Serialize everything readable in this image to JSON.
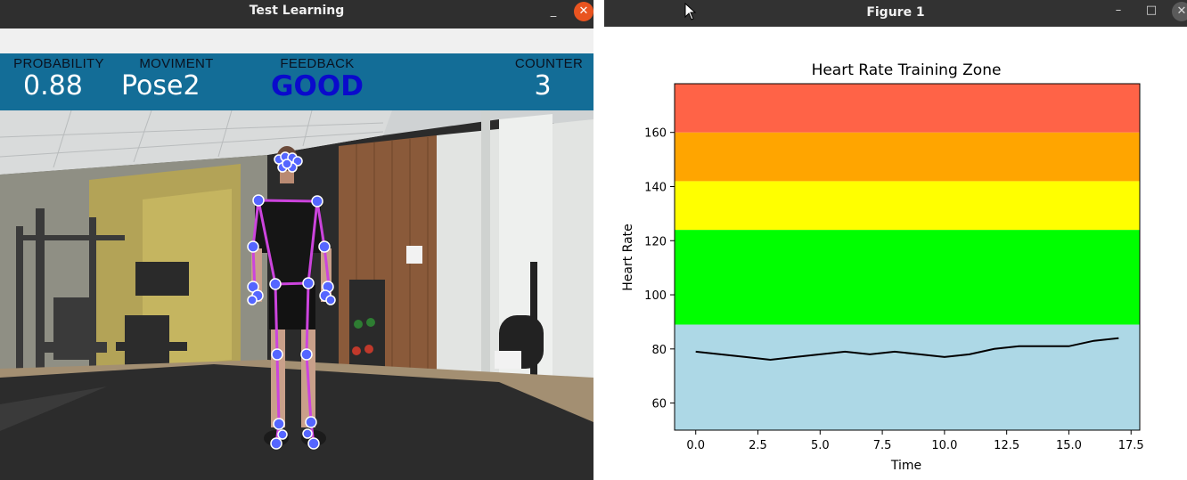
{
  "left_window": {
    "title": "Test Learning",
    "minimize_glyph": "_",
    "close_glyph": "✕",
    "stats": {
      "probability_label": "PROBABILITY",
      "probability_value": "0.88",
      "moviment_label": "MOVIMENT",
      "moviment_value": "Pose2",
      "feedback_label": "FEEDBACK",
      "feedback_value": "GOOD",
      "counter_label": "COUNTER",
      "counter_value": "3"
    },
    "colors": {
      "stats_bar": "#136d97",
      "feedback_text": "#0a0acc",
      "skeleton_line": "#cc44dd",
      "landmark": "#5566ff"
    }
  },
  "right_window": {
    "title": "Figure 1",
    "minimize_glyph": "–",
    "maximize_glyph": "□",
    "close_glyph": "✕"
  },
  "chart_data": {
    "type": "line",
    "title": "Heart Rate Training Zone",
    "xlabel": "Time",
    "ylabel": "Heart Rate",
    "xlim": [
      -0.85,
      17.85
    ],
    "ylim": [
      50,
      178
    ],
    "xticks": [
      0.0,
      2.5,
      5.0,
      7.5,
      10.0,
      12.5,
      15.0,
      17.5
    ],
    "xtick_labels": [
      "0.0",
      "2.5",
      "5.0",
      "7.5",
      "10.0",
      "12.5",
      "15.0",
      "17.5"
    ],
    "yticks": [
      60,
      80,
      100,
      120,
      140,
      160
    ],
    "ytick_labels": [
      "60",
      "80",
      "100",
      "120",
      "140",
      "160"
    ],
    "zones": [
      {
        "from": 50,
        "to": 89,
        "color": "#add8e6"
      },
      {
        "from": 89,
        "to": 124,
        "color": "#00ff00"
      },
      {
        "from": 124,
        "to": 142,
        "color": "#ffff00"
      },
      {
        "from": 142,
        "to": 160,
        "color": "#ffa500"
      },
      {
        "from": 160,
        "to": 178,
        "color": "#ff6347"
      }
    ],
    "series": [
      {
        "color": "#000000",
        "x": [
          0,
          1,
          2,
          3,
          4,
          5,
          6,
          7,
          8,
          9,
          10,
          11,
          12,
          13,
          14,
          15,
          16,
          17
        ],
        "y": [
          79,
          78,
          77,
          76,
          77,
          78,
          79,
          78,
          79,
          78,
          77,
          78,
          80,
          81,
          81,
          81,
          83,
          84
        ]
      }
    ],
    "grid": false,
    "legend": "none"
  }
}
